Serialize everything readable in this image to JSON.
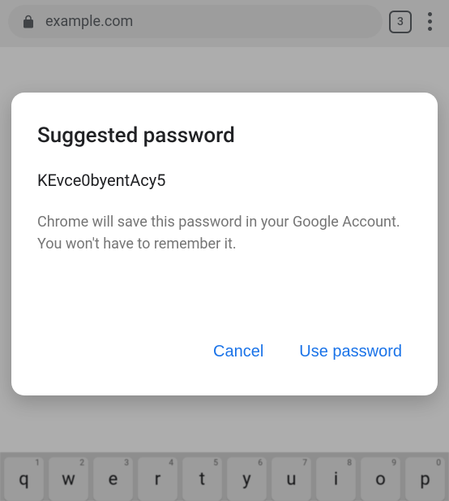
{
  "browser": {
    "url": "example.com",
    "tab_count": "3"
  },
  "dialog": {
    "title": "Suggested password",
    "password": "KEvce0byentAcy5",
    "description": "Chrome will save this password in your Google Account. You won't have to remember it.",
    "cancel_label": "Cancel",
    "use_label": "Use password"
  },
  "keyboard": {
    "row": [
      {
        "letter": "q",
        "num": "1"
      },
      {
        "letter": "w",
        "num": "2"
      },
      {
        "letter": "e",
        "num": "3"
      },
      {
        "letter": "r",
        "num": "4"
      },
      {
        "letter": "t",
        "num": "5"
      },
      {
        "letter": "y",
        "num": "6"
      },
      {
        "letter": "u",
        "num": "7"
      },
      {
        "letter": "i",
        "num": "8"
      },
      {
        "letter": "o",
        "num": "9"
      },
      {
        "letter": "p",
        "num": "0"
      }
    ]
  }
}
